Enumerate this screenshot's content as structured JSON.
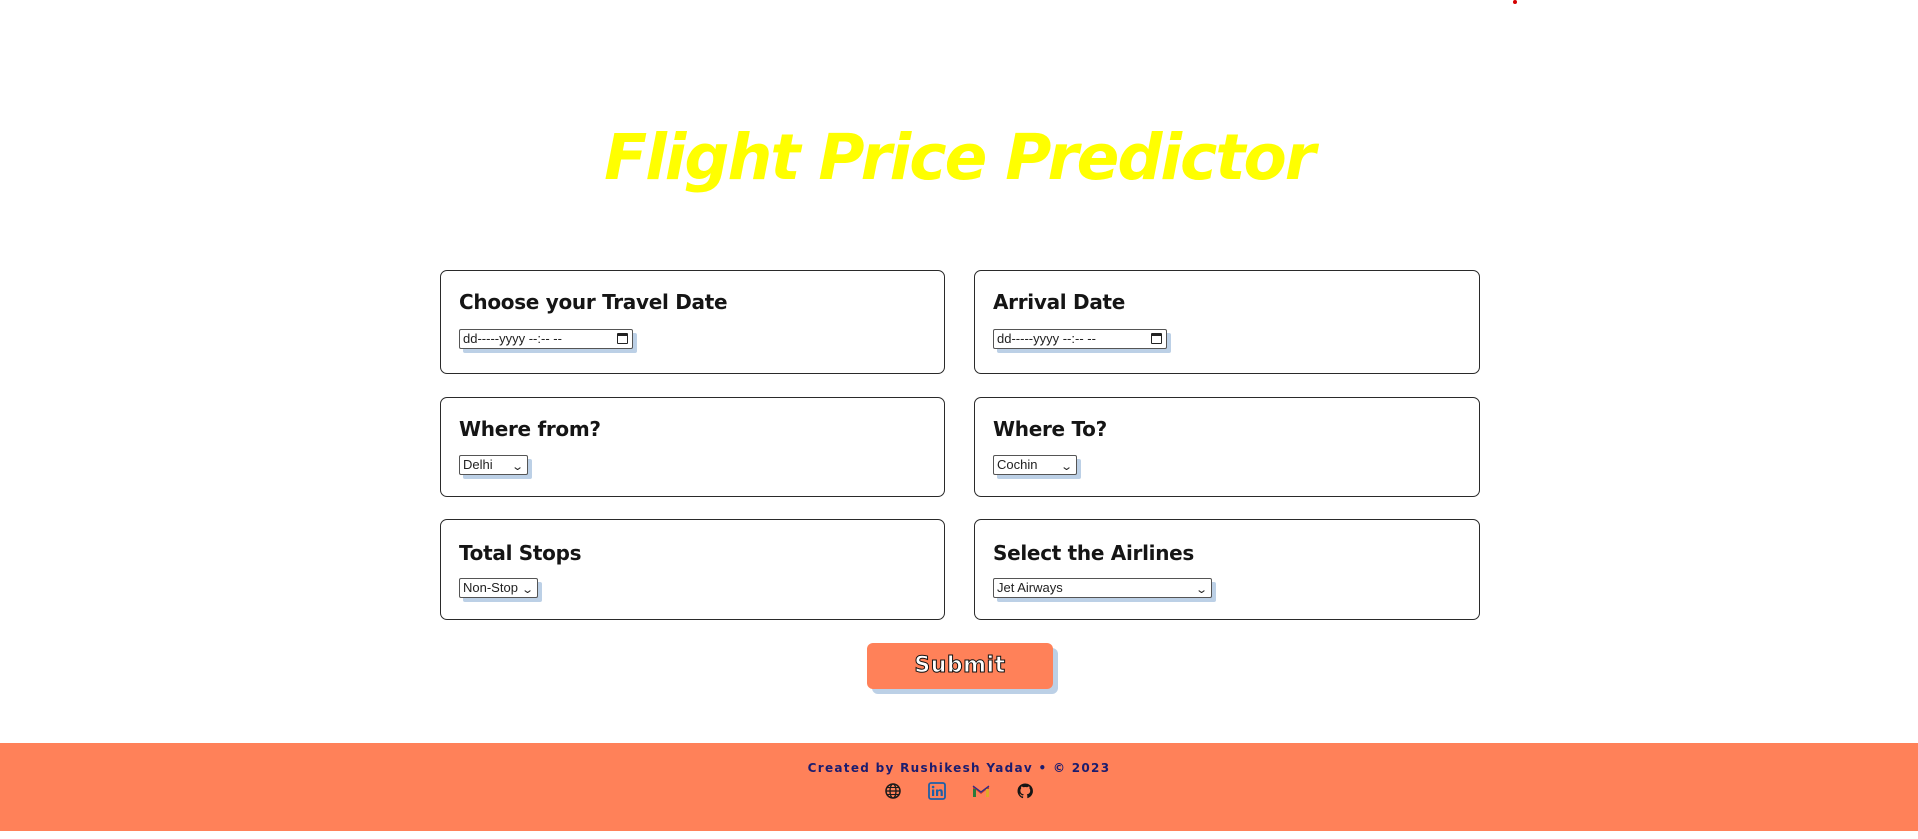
{
  "title": "Flight Price Predictor",
  "form": {
    "travel_date": {
      "label": "Choose your Travel Date",
      "placeholder": "dd-----yyyy --:-- --"
    },
    "arrival_date": {
      "label": "Arrival Date",
      "placeholder": "dd-----yyyy --:-- --"
    },
    "source": {
      "label": "Where from?",
      "value": "Delhi"
    },
    "destination": {
      "label": "Where To?",
      "value": "Cochin"
    },
    "stops": {
      "label": "Total Stops",
      "value": "Non-Stop"
    },
    "airline": {
      "label": "Select the Airlines",
      "value": "Jet Airways"
    },
    "submit_label": "Submit"
  },
  "footer": {
    "credit": "Created by Rushikesh Yadav • © 2023",
    "icons": [
      "globe-icon",
      "linkedin-icon",
      "gmail-icon",
      "github-icon"
    ]
  },
  "colors": {
    "title": "#ffff00",
    "accent": "#ff8159",
    "footer_text": "#1c1c6e",
    "control_shadow": "#bcd0e6"
  }
}
